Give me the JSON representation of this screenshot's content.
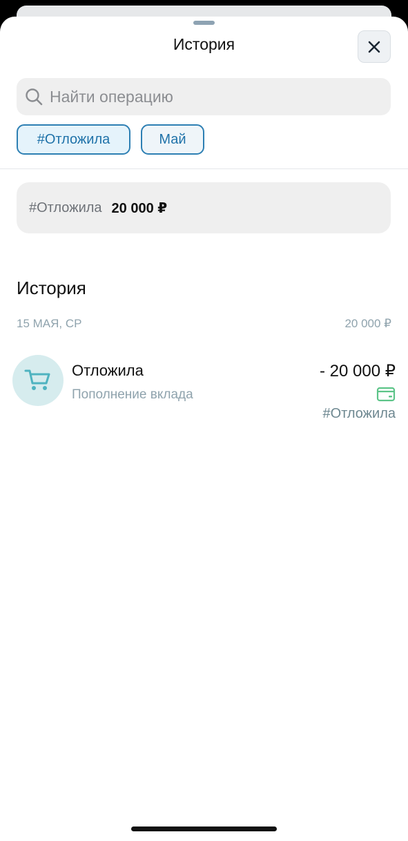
{
  "header": {
    "title": "История",
    "close_icon": "close-icon"
  },
  "search": {
    "placeholder": "Найти операцию",
    "icon": "search-icon"
  },
  "filters": [
    {
      "label": "#Отложила",
      "selected": true
    },
    {
      "label": "Май",
      "selected": false
    }
  ],
  "summary": {
    "tag": "#Отложила",
    "amount": "20 000 ₽"
  },
  "history": {
    "title": "История",
    "groups": [
      {
        "date": "15 МАЯ, СР",
        "total": "20 000 ₽",
        "items": [
          {
            "title": "Отложила",
            "subtitle": "Пополнение вклада",
            "amount": "- 20 000 ₽",
            "tag": "#Отложила",
            "icon": "shopping-cart-icon",
            "payment_icon": "card-icon"
          }
        ]
      }
    ]
  },
  "colors": {
    "accent": "#1f72a9",
    "chip_selected_bg": "#e5f3fb",
    "icon_bg": "#d6ecee",
    "icon_color": "#4fb3c0",
    "card_icon_color": "#5cc488",
    "muted_text": "#8fa3ad"
  }
}
